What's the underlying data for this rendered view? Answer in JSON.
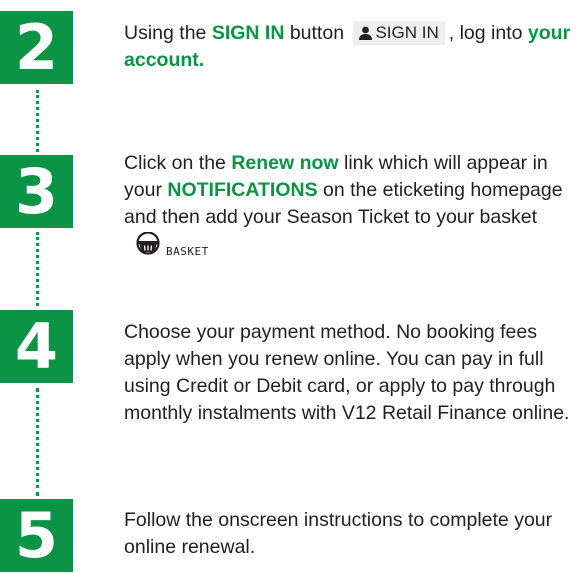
{
  "steps": [
    {
      "number": "2",
      "before": "Using the ",
      "highlight1": "SIGN IN",
      "middle": " button ",
      "button_label": "SIGN IN",
      "after": ", log into ",
      "highlight2": "your account."
    },
    {
      "number": "3",
      "part1": "Click on the ",
      "highlight1": "Renew now",
      "part2": " link which will appear in your ",
      "highlight2": "NOTIFICATIONS",
      "part3": " on the eticketing homepage and then add your Season Ticket to your basket",
      "basket_label": "BASKET"
    },
    {
      "number": "4",
      "text": "Choose your payment method. No booking fees apply when you renew online. You can pay in full using Credit or Debit card, or apply to pay through monthly instalments with V12 Retail Finance online."
    },
    {
      "number": "5",
      "text": "Follow the onscreen instructions to complete your online renewal."
    }
  ],
  "colors": {
    "accent": "#0b9445",
    "text": "#231f20",
    "button_bg": "#eeeeee"
  },
  "icons": {
    "signin": "user-icon",
    "basket": "basket-icon"
  }
}
